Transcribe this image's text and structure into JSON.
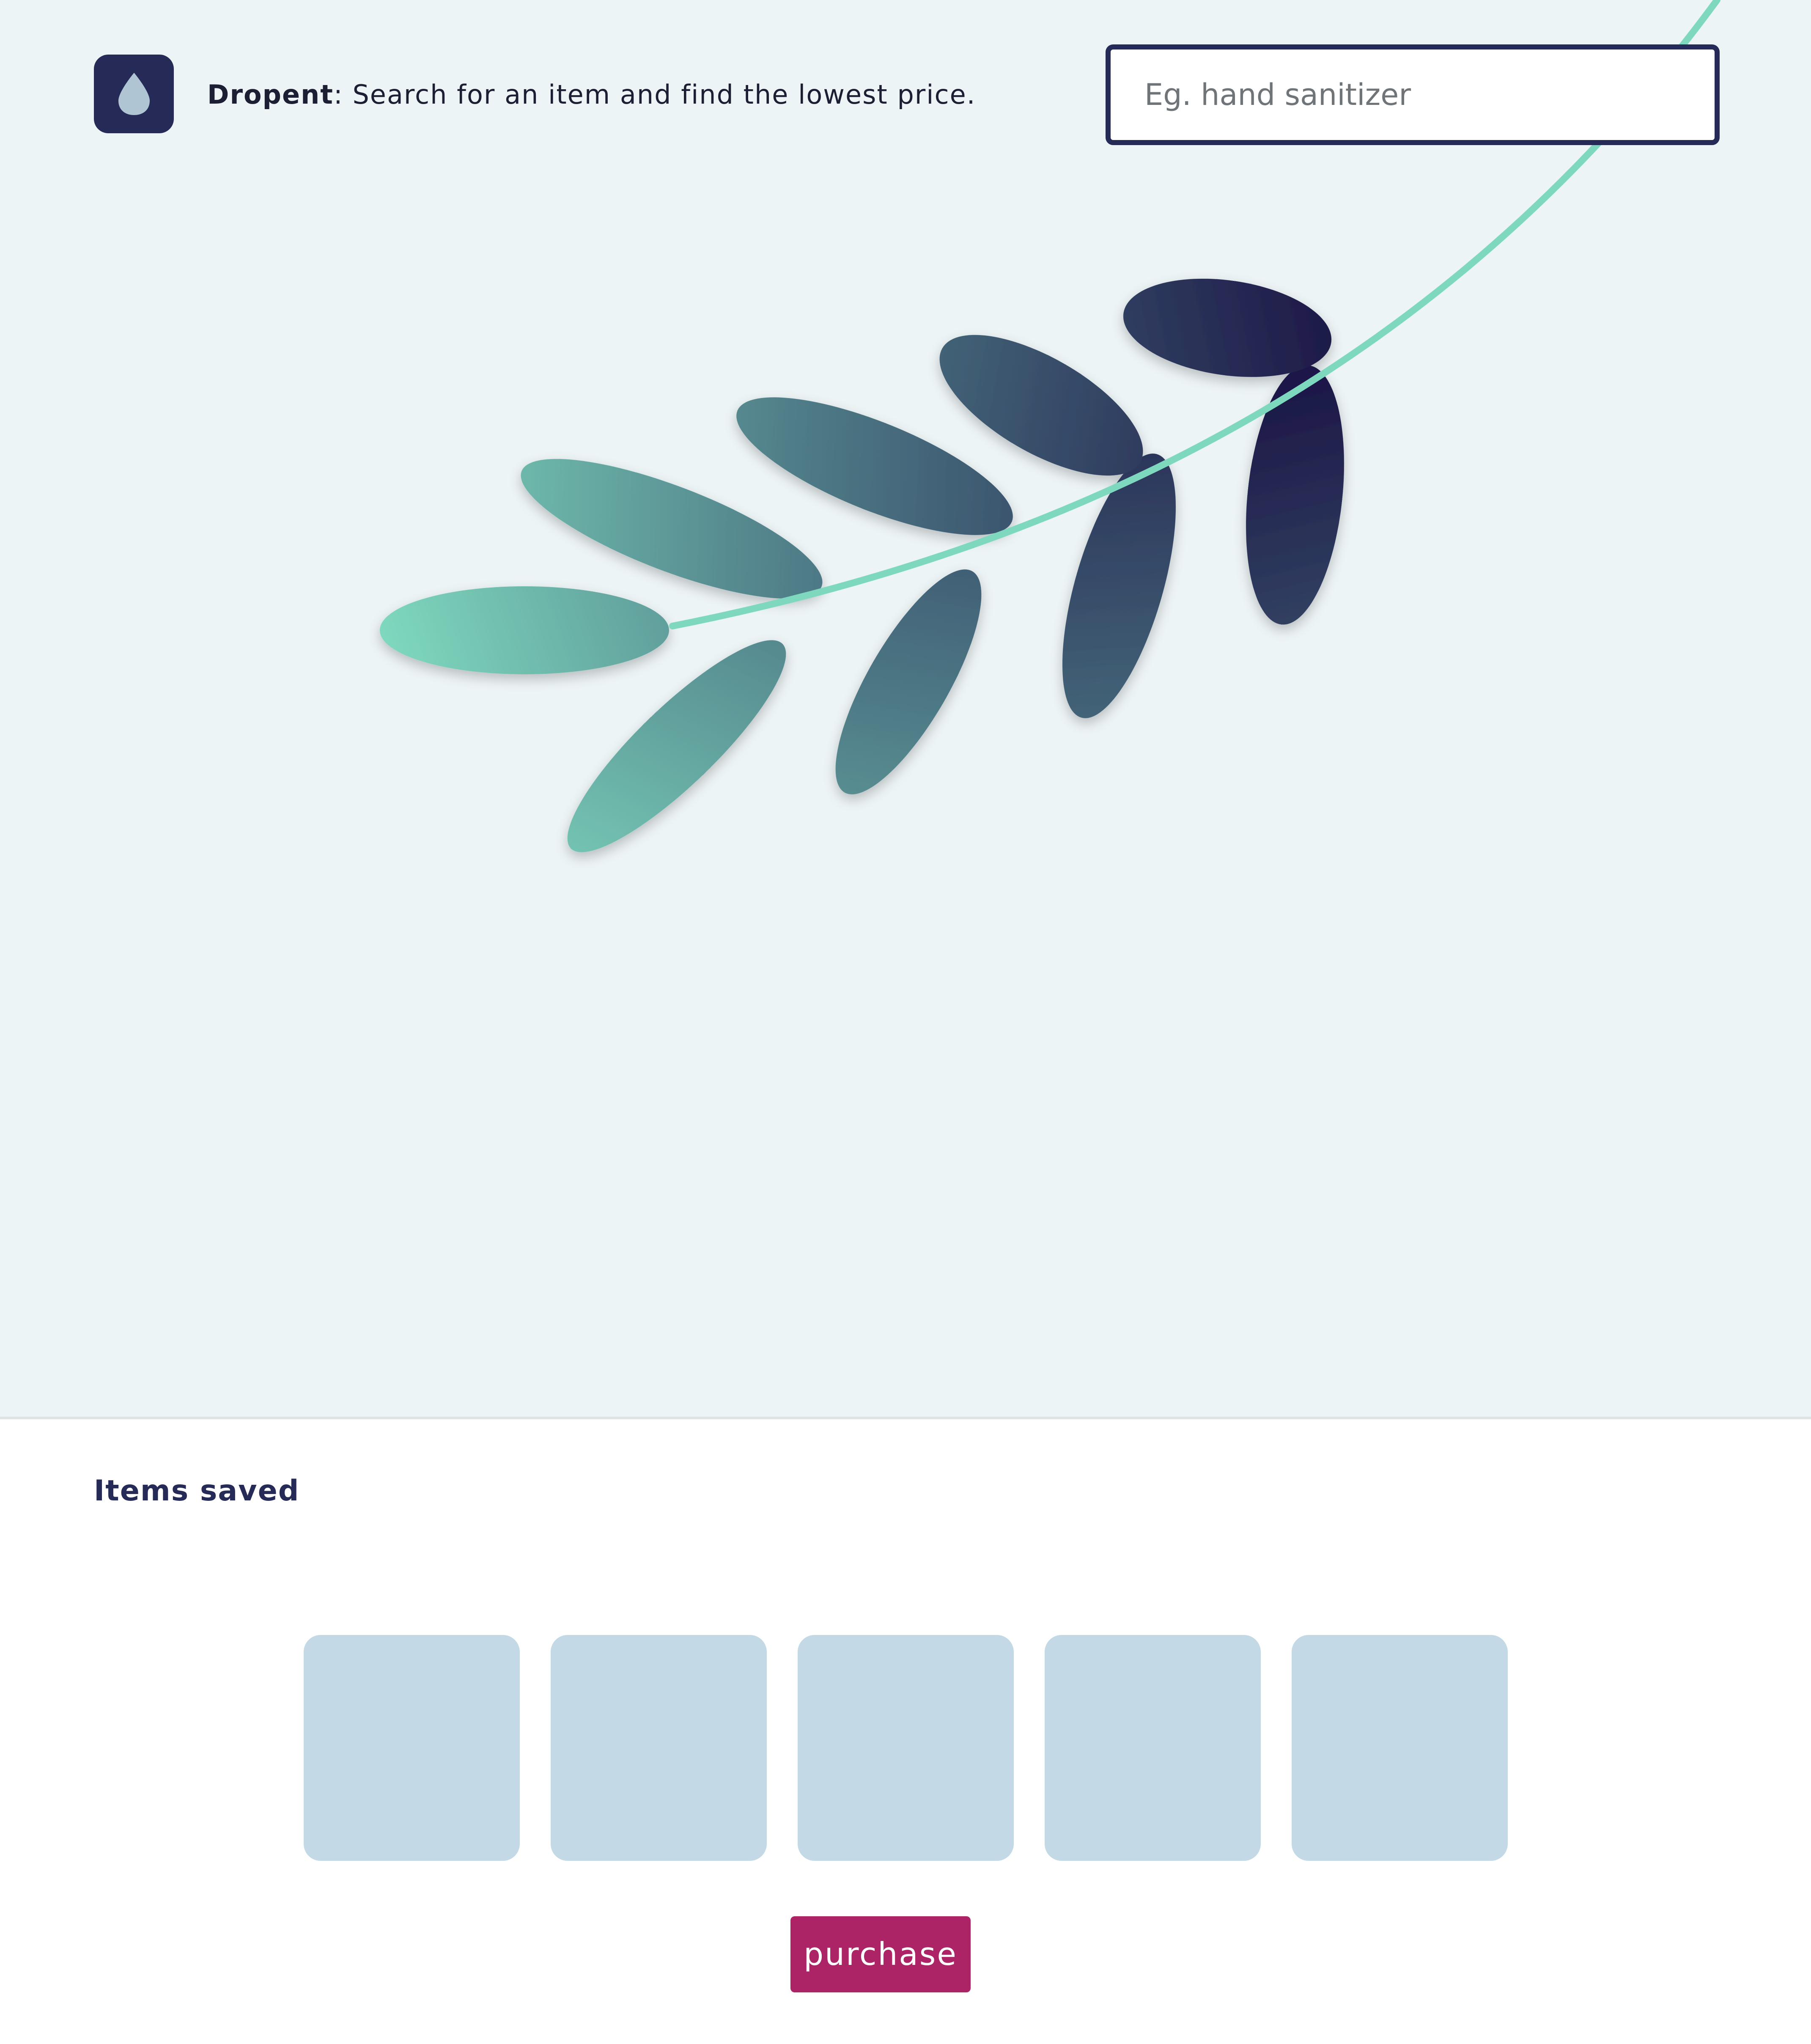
{
  "header": {
    "brand": "Dropent",
    "tagline": ": Search for an item and find the lowest price.",
    "logo_icon": "water-drop-icon"
  },
  "search": {
    "placeholder": "Eg. hand sanitizer",
    "value": ""
  },
  "saved_items": {
    "title": "Items saved",
    "slot_count": 5,
    "purchase_label": "purchase"
  },
  "colors": {
    "background": "#edf4f6",
    "navy": "#262a56",
    "mint": "#7ed8be",
    "slot": "#c3dae6",
    "purchase": "#ad2466"
  }
}
